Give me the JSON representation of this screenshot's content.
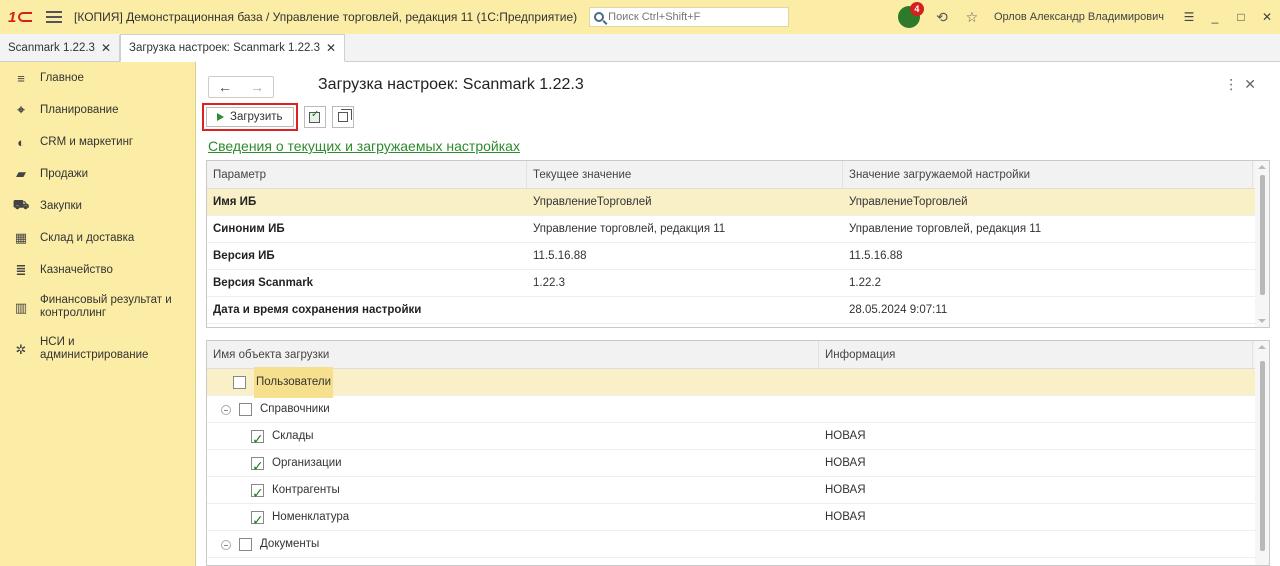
{
  "titlebar": {
    "window_title": "[КОПИЯ] Демонстрационная база / Управление торговлей, редакция 11  (1С:Предприятие)",
    "search_placeholder": "Поиск Ctrl+Shift+F",
    "notification_count": "4",
    "user_name": "Орлов Александр Владимирович"
  },
  "tabs": [
    {
      "label": "Scanmark 1.22.3"
    },
    {
      "label": "Загрузка настроек: Scanmark 1.22.3"
    }
  ],
  "sidebar": {
    "items": [
      {
        "label": "Главное",
        "icon": "menu-lines-icon"
      },
      {
        "label": "Планирование",
        "icon": "planning-icon"
      },
      {
        "label": "CRM и маркетинг",
        "icon": "crm-icon"
      },
      {
        "label": "Продажи",
        "icon": "sales-icon"
      },
      {
        "label": "Закупки",
        "icon": "cart-icon"
      },
      {
        "label": "Склад и доставка",
        "icon": "warehouse-icon"
      },
      {
        "label": "Казначейство",
        "icon": "treasury-icon"
      },
      {
        "label": "Финансовый результат и контроллинг",
        "icon": "bar-chart-icon"
      },
      {
        "label": "НСИ и администрирование",
        "icon": "gear-icon"
      }
    ]
  },
  "form": {
    "title": "Загрузка настроек: Scanmark 1.22.3",
    "load_button": "Загрузить",
    "section_link": "Сведения о текущих и загружаемых настройках"
  },
  "settings_table": {
    "headers": [
      "Параметр",
      "Текущее значение",
      "Значение загружаемой настройки"
    ],
    "rows": [
      {
        "param": "Имя ИБ",
        "current": "УправлениеТорговлей",
        "loaded": "УправлениеТорговлей"
      },
      {
        "param": "Синоним ИБ",
        "current": "Управление торговлей, редакция 11",
        "loaded": "Управление торговлей, редакция 11"
      },
      {
        "param": "Версия ИБ",
        "current": "11.5.16.88",
        "loaded": "11.5.16.88"
      },
      {
        "param": "Версия Scanmark",
        "current": "1.22.3",
        "loaded": "1.22.2"
      },
      {
        "param": "Дата и время сохранения настройки",
        "current": "",
        "loaded": "28.05.2024 9:07:11"
      }
    ]
  },
  "objects_table": {
    "headers": [
      "Имя объекта загрузки",
      "Информация"
    ],
    "rows": [
      {
        "label": "Пользователи",
        "info": "",
        "checked": false
      },
      {
        "label": "Справочники",
        "info": "",
        "checked": false
      },
      {
        "label": "Склады",
        "info": "НОВАЯ",
        "checked": true
      },
      {
        "label": "Организации",
        "info": "НОВАЯ",
        "checked": true
      },
      {
        "label": "Контрагенты",
        "info": "НОВАЯ",
        "checked": true
      },
      {
        "label": "Номенклатура",
        "info": "НОВАЯ",
        "checked": true
      },
      {
        "label": "Документы",
        "info": "",
        "checked": false
      }
    ]
  },
  "colors": {
    "panel_yellow": "#fbeda5",
    "accent_green": "#2e8b2e",
    "highlight_red": "#e02020"
  }
}
